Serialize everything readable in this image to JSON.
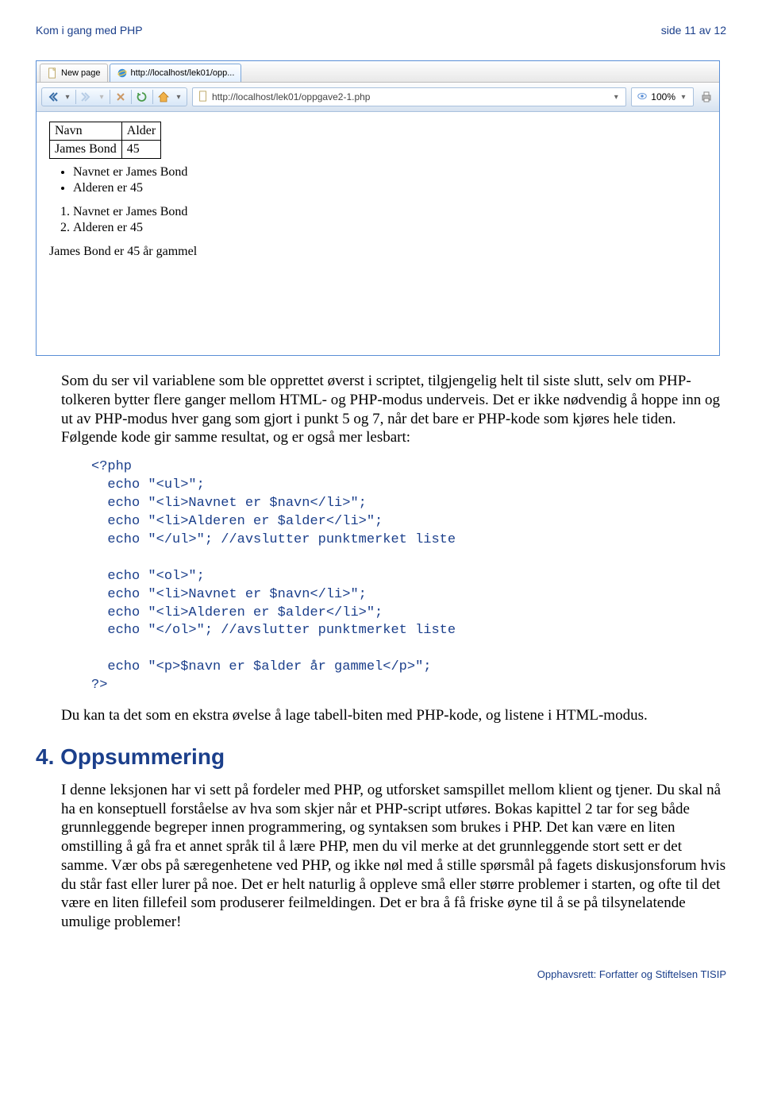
{
  "header": {
    "left": "Kom i gang med PHP",
    "right": "side 11 av 12"
  },
  "browser": {
    "tabs": [
      {
        "label": "New page",
        "icon": "page"
      },
      {
        "label": "http://localhost/lek01/opp...",
        "icon": "ie"
      }
    ],
    "address": "http://localhost/lek01/oppgave2-1.php",
    "zoom": "100%"
  },
  "rendered": {
    "table": {
      "headers": [
        "Navn",
        "Alder"
      ],
      "row": [
        "James Bond",
        "45"
      ]
    },
    "ul": [
      "Navnet er James Bond",
      "Alderen er 45"
    ],
    "ol": [
      "Navnet er James Bond",
      "Alderen er 45"
    ],
    "para": "James Bond er 45 år gammel"
  },
  "para1": "Som du ser vil variablene som ble opprettet øverst i scriptet, tilgjengelig helt til siste slutt, selv om PHP-tolkeren bytter flere ganger mellom HTML- og PHP-modus underveis. Det er ikke nødvendig å hoppe inn og ut av PHP-modus hver gang som gjort i punkt 5 og 7, når det bare er PHP-kode som kjøres hele tiden. Følgende kode gir samme resultat, og er også mer lesbart:",
  "code": "<?php\n  echo \"<ul>\";\n  echo \"<li>Navnet er $navn</li>\";\n  echo \"<li>Alderen er $alder</li>\";\n  echo \"</ul>\"; //avslutter punktmerket liste\n\n  echo \"<ol>\";\n  echo \"<li>Navnet er $navn</li>\";\n  echo \"<li>Alderen er $alder</li>\";\n  echo \"</ol>\"; //avslutter punktmerket liste\n\n  echo \"<p>$navn er $alder år gammel</p>\";\n?>",
  "para2": "Du kan ta det som en ekstra øvelse å lage tabell-biten med PHP-kode, og listene i HTML-modus.",
  "heading": "4. Oppsummering",
  "para3": "I denne leksjonen har vi sett på fordeler med PHP, og utforsket samspillet mellom klient og tjener. Du skal nå ha en konseptuell forståelse av hva som skjer når et PHP-script utføres. Bokas kapittel 2 tar for seg både grunnleggende begreper innen programmering, og syntaksen som brukes i PHP. Det kan være en liten omstilling å gå fra et annet språk til å lære PHP, men du vil merke at det grunnleggende stort sett er det samme. Vær obs på særegenhetene ved PHP, og ikke nøl med å stille spørsmål på fagets diskusjonsforum hvis du står fast eller lurer på noe. Det er helt naturlig å oppleve små eller større problemer i starten, og ofte til det være en liten fillefeil som produserer feilmeldingen. Det er bra å få friske øyne til å se på tilsynelatende umulige problemer!",
  "footer": "Opphavsrett:  Forfatter og Stiftelsen TISIP"
}
